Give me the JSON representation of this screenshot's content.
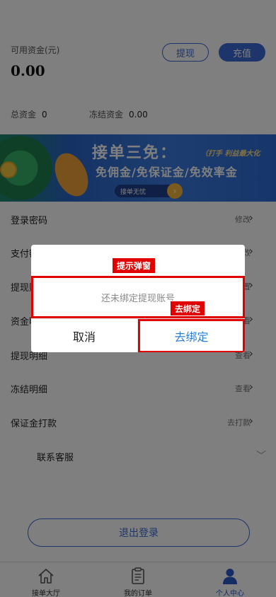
{
  "account": {
    "available_label": "可用资金(元)",
    "available_value": "0.00",
    "withdraw_label": "提现",
    "recharge_label": "充值",
    "total_label": "总资金",
    "total_value": "0",
    "frozen_label": "冻结资金",
    "frozen_value": "0.00"
  },
  "banner": {
    "title": "接单三免：",
    "tagline": "（打手 利益最大化",
    "line2": "免佣金/免保证金/免效率金",
    "pill": "接单无忧"
  },
  "menu": [
    {
      "label": "登录密码",
      "right": "修改"
    },
    {
      "label": "支付密码",
      "right": "修改"
    },
    {
      "label": "提现账号",
      "right": "设置"
    },
    {
      "label": "资金明细",
      "right": "查看"
    },
    {
      "label": "提现明细",
      "right": "查看"
    },
    {
      "label": "冻结明细",
      "right": "查看"
    },
    {
      "label": "保证金打款",
      "right": "去打款"
    }
  ],
  "service": {
    "label": "联系客服"
  },
  "logout_label": "退出登录",
  "tabs": [
    {
      "label": "接单大厅",
      "icon": "home-icon"
    },
    {
      "label": "我的订单",
      "icon": "clipboard-icon"
    },
    {
      "label": "个人中心",
      "icon": "user-icon"
    }
  ],
  "modal": {
    "message": "还未绑定提现账号",
    "cancel_label": "取消",
    "bind_label": "去绑定"
  },
  "annotations": {
    "popup": "提示弹窗",
    "bind": "去绑定"
  },
  "colors": {
    "accent": "#3a6ad4",
    "annotation": "#e00000"
  }
}
